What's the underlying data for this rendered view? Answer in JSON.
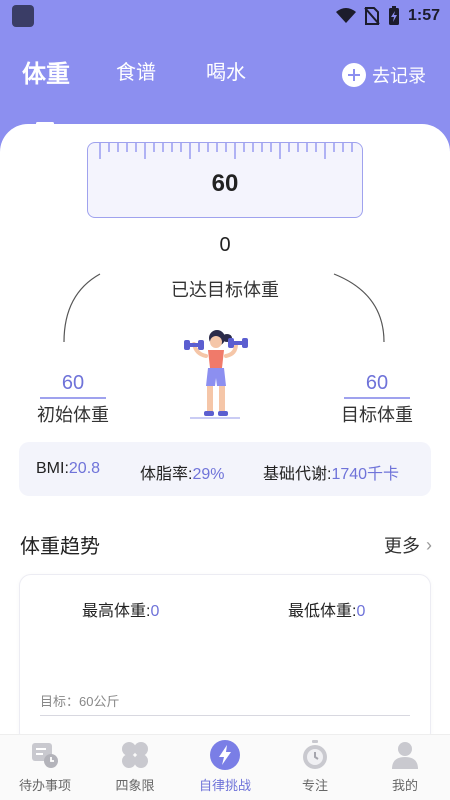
{
  "status": {
    "time": "1:57"
  },
  "header": {
    "tabs": [
      {
        "label": "体重",
        "active": true
      },
      {
        "label": "食谱",
        "active": false
      },
      {
        "label": "喝水",
        "active": false
      }
    ],
    "record_label": "去记录"
  },
  "weight": {
    "ruler_value": "60",
    "progress_value": "0",
    "progress_label": "已达目标体重",
    "start_value": "60",
    "start_label": "初始体重",
    "goal_value": "60",
    "goal_label": "目标体重"
  },
  "stats": {
    "bmi_label": "BMI:",
    "bmi_value": "20.8",
    "fat_label": "体脂率:",
    "fat_value": "29%",
    "bmr_label": "基础代谢:",
    "bmr_value": "1740千卡"
  },
  "trend": {
    "title": "体重趋势",
    "more_label": "更多",
    "max_label": "最高体重:",
    "max_value": "0",
    "min_label": "最低体重:",
    "min_value": "0",
    "target_text": "目标：60公斤"
  },
  "nav": [
    {
      "label": "待办事项",
      "icon": "todo-icon",
      "active": false
    },
    {
      "label": "四象限",
      "icon": "quadrant-icon",
      "active": false
    },
    {
      "label": "自律挑战",
      "icon": "lightning-icon",
      "active": true
    },
    {
      "label": "专注",
      "icon": "stopwatch-icon",
      "active": false
    },
    {
      "label": "我的",
      "icon": "profile-icon",
      "active": false
    }
  ],
  "colors": {
    "accent": "#8c8ff0",
    "accent_text": "#6f73d9"
  }
}
